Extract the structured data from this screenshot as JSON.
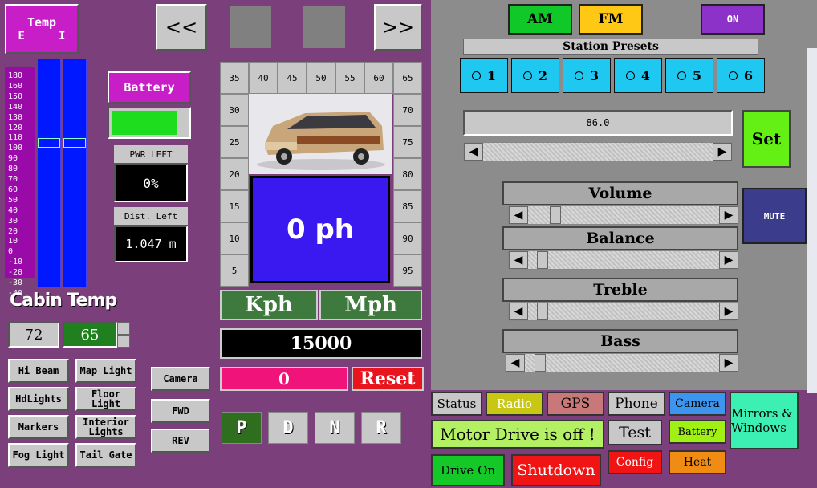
{
  "temp": {
    "title": "Temp",
    "sub": "E     I",
    "scale": [
      "180",
      "160",
      "150",
      "140",
      "130",
      "120",
      "110",
      "100",
      "90",
      "80",
      "70",
      "60",
      "50",
      "40",
      "30",
      "20",
      "10",
      "0",
      "-10",
      "-20",
      "-30",
      "-40"
    ]
  },
  "nav": {
    "prev": "<<",
    "next": ">>"
  },
  "battery": {
    "label": "Battery",
    "level": 0.85
  },
  "pwr_left": {
    "label": "PWR LEFT",
    "value": "0%"
  },
  "dist_left": {
    "label": "Dist. Left",
    "value": "1.047 m"
  },
  "cabin": {
    "title": "Cabin Temp",
    "current": "72",
    "set": "65"
  },
  "lights": {
    "hi_beam": "Hi Beam",
    "hdlights": "HdLights",
    "markers": "Markers",
    "fog": "Fog Light",
    "map": "Map Light",
    "floor": "Floor Light",
    "interior": "Interior Lights",
    "tailgate": "Tail Gate"
  },
  "camera_ctrl": {
    "camera": "Camera",
    "fwd": "FWD",
    "rev": "REV"
  },
  "speedo": {
    "top": [
      "35",
      "40",
      "45",
      "50",
      "55",
      "60",
      "65"
    ],
    "left": [
      "30",
      "25",
      "20",
      "15",
      "10",
      "5"
    ],
    "right": [
      "70",
      "75",
      "80",
      "85",
      "90",
      "95"
    ],
    "speed": "0 ph",
    "units": [
      "Kph",
      "Mph"
    ],
    "odometer": "15000",
    "trip": "0",
    "reset": "Reset"
  },
  "gears": [
    "P",
    "D",
    "N",
    "R"
  ],
  "radio": {
    "am": "AM",
    "fm": "FM",
    "power": "ON",
    "presets_title": "Station Presets",
    "presets": [
      "1",
      "2",
      "3",
      "4",
      "5",
      "6"
    ],
    "frequency": "86.0",
    "set": "Set",
    "mute": "MUTE",
    "sliders": [
      {
        "label": "Volume",
        "value": 0.12
      },
      {
        "label": "Balance",
        "value": 0.05
      },
      {
        "label": "Treble",
        "value": 0.05
      },
      {
        "label": "Bass",
        "value": 0.05
      }
    ]
  },
  "tabs": {
    "status": "Status",
    "radio": "Radio",
    "gps": "GPS",
    "phone": "Phone",
    "camera": "Camera",
    "mirrors": "Mirrors & Windows",
    "motor": "Motor Drive is off !",
    "test": "Test",
    "battery": "Battery",
    "drive_on": "Drive On",
    "shutdown": "Shutdown",
    "config": "Config",
    "heat": "Heat"
  },
  "colors": {
    "panel_bg": "#7b3f7b",
    "radio_bg": "#8c8c8c",
    "speed_bg": "#3a18f0",
    "accent_green": "#1edc1e"
  }
}
